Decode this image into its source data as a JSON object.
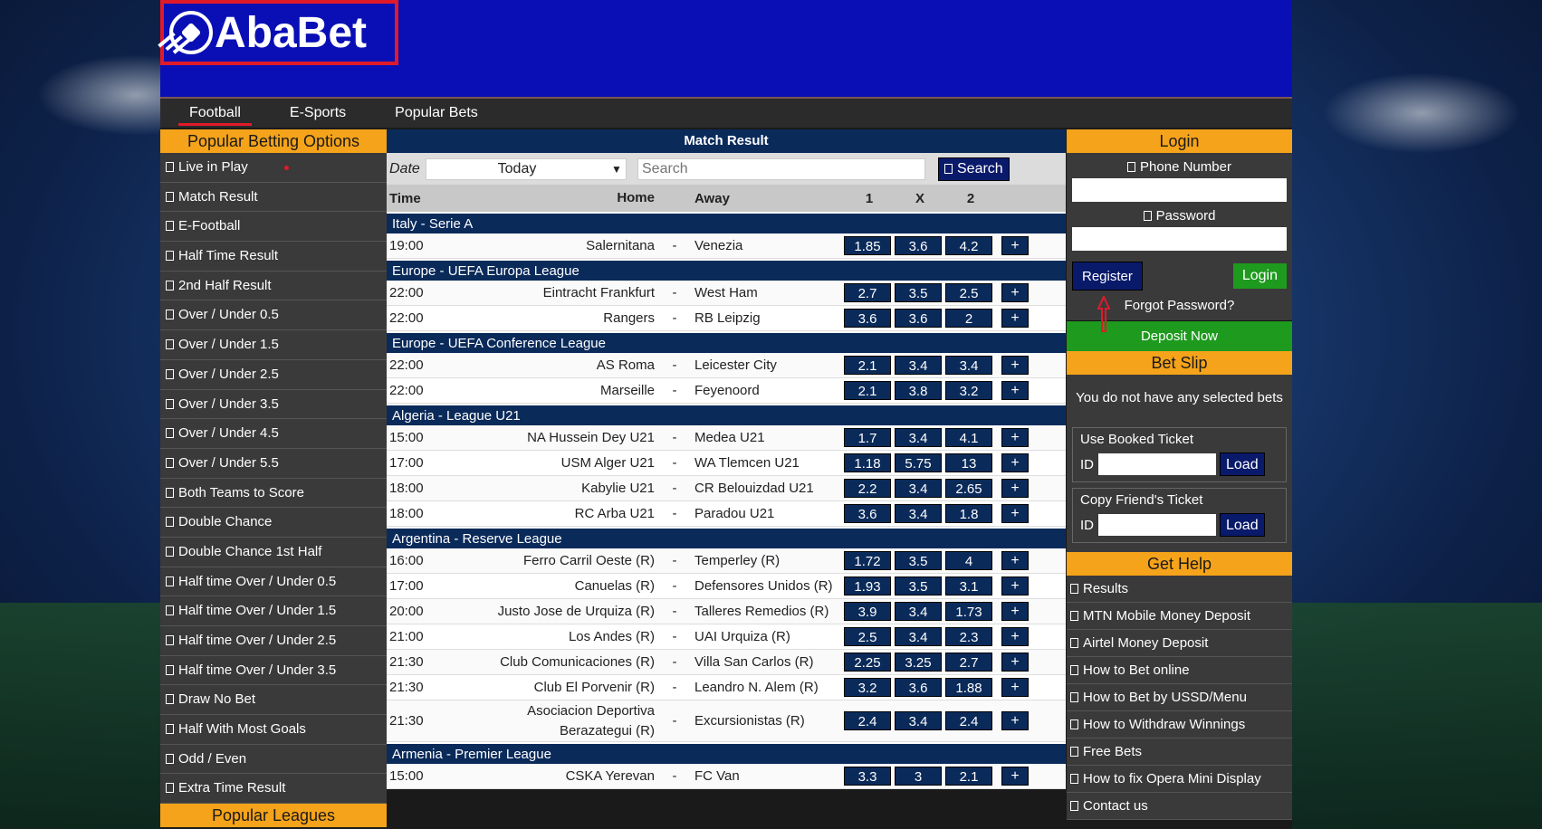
{
  "brand": {
    "name": "AbaBet",
    "accent": "#f5a31a",
    "header_bg": "#0a0fb5",
    "navy": "#0a2a5a",
    "green": "#1e9a1e"
  },
  "nav": {
    "tabs": [
      {
        "label": "Football",
        "active": true
      },
      {
        "label": "E-Sports"
      },
      {
        "label": "Popular Bets"
      }
    ]
  },
  "left": {
    "heading": "Popular Betting Options",
    "items": [
      "Live in Play",
      "Match Result",
      "E-Football",
      "Half Time Result",
      "2nd Half Result",
      "Over / Under 0.5",
      "Over / Under 1.5",
      "Over / Under 2.5",
      "Over / Under 3.5",
      "Over / Under 4.5",
      "Over / Under 5.5",
      "Both Teams to Score",
      "Double Chance",
      "Double Chance 1st Half",
      "Half time Over / Under 0.5",
      "Half time Over / Under 1.5",
      "Half time Over / Under 2.5",
      "Half time Over / Under 3.5",
      "Draw No Bet",
      "Half With Most Goals",
      "Odd / Even",
      "Extra Time Result"
    ],
    "footer_heading": "Popular Leagues"
  },
  "center": {
    "title": "Match Result",
    "filter": {
      "date_label": "Date",
      "date_value": "Today",
      "search_placeholder": "Search",
      "search_button": "Search"
    },
    "columns": {
      "time": "Time",
      "home": "Home",
      "away": "Away",
      "one": "1",
      "x": "X",
      "two": "2"
    },
    "leagues": [
      {
        "name": "Italy - Serie A",
        "matches": [
          {
            "time": "19:00",
            "home": "Salernitana",
            "away": "Venezia",
            "odds": [
              "1.85",
              "3.6",
              "4.2"
            ]
          }
        ]
      },
      {
        "name": "Europe - UEFA Europa League",
        "matches": [
          {
            "time": "22:00",
            "home": "Eintracht Frankfurt",
            "away": "West Ham",
            "odds": [
              "2.7",
              "3.5",
              "2.5"
            ]
          },
          {
            "time": "22:00",
            "home": "Rangers",
            "away": "RB Leipzig",
            "odds": [
              "3.6",
              "3.6",
              "2"
            ]
          }
        ]
      },
      {
        "name": "Europe - UEFA Conference League",
        "matches": [
          {
            "time": "22:00",
            "home": "AS Roma",
            "away": "Leicester City",
            "odds": [
              "2.1",
              "3.4",
              "3.4"
            ]
          },
          {
            "time": "22:00",
            "home": "Marseille",
            "away": "Feyenoord",
            "odds": [
              "2.1",
              "3.8",
              "3.2"
            ]
          }
        ]
      },
      {
        "name": "Algeria - League U21",
        "matches": [
          {
            "time": "15:00",
            "home": "NA Hussein Dey U21",
            "away": "Medea U21",
            "odds": [
              "1.7",
              "3.4",
              "4.1"
            ]
          },
          {
            "time": "17:00",
            "home": "USM Alger U21",
            "away": "WA Tlemcen U21",
            "odds": [
              "1.18",
              "5.75",
              "13"
            ]
          },
          {
            "time": "18:00",
            "home": "Kabylie U21",
            "away": "CR Belouizdad U21",
            "odds": [
              "2.2",
              "3.4",
              "2.65"
            ]
          },
          {
            "time": "18:00",
            "home": "RC Arba U21",
            "away": "Paradou U21",
            "odds": [
              "3.6",
              "3.4",
              "1.8"
            ]
          }
        ]
      },
      {
        "name": "Argentina - Reserve League",
        "matches": [
          {
            "time": "16:00",
            "home": "Ferro Carril Oeste (R)",
            "away": "Temperley (R)",
            "odds": [
              "1.72",
              "3.5",
              "4"
            ]
          },
          {
            "time": "17:00",
            "home": "Canuelas (R)",
            "away": "Defensores Unidos (R)",
            "odds": [
              "1.93",
              "3.5",
              "3.1"
            ]
          },
          {
            "time": "20:00",
            "home": "Justo Jose de Urquiza (R)",
            "away": "Talleres Remedios (R)",
            "odds": [
              "3.9",
              "3.4",
              "1.73"
            ]
          },
          {
            "time": "21:00",
            "home": "Los Andes (R)",
            "away": "UAI Urquiza (R)",
            "odds": [
              "2.5",
              "3.4",
              "2.3"
            ]
          },
          {
            "time": "21:30",
            "home": "Club Comunicaciones (R)",
            "away": "Villa San Carlos (R)",
            "odds": [
              "2.25",
              "3.25",
              "2.7"
            ]
          },
          {
            "time": "21:30",
            "home": "Club El Porvenir (R)",
            "away": "Leandro N. Alem (R)",
            "odds": [
              "3.2",
              "3.6",
              "1.88"
            ]
          },
          {
            "time": "21:30",
            "home": "Asociacion Deportiva Berazategui (R)",
            "away": "Excursionistas (R)",
            "odds": [
              "2.4",
              "3.4",
              "2.4"
            ],
            "tall": true
          }
        ]
      },
      {
        "name": "Armenia - Premier League",
        "matches": [
          {
            "time": "15:00",
            "home": "CSKA Yerevan",
            "away": "FC Van",
            "odds": [
              "3.3",
              "3",
              "2.1"
            ]
          }
        ]
      }
    ],
    "dash": "-",
    "plus": "+"
  },
  "right": {
    "login_heading": "Login",
    "phone_label": "Phone Number",
    "password_label": "Password",
    "register_button": "Register",
    "login_button": "Login",
    "forgot": "Forgot Password?",
    "deposit": "Deposit Now",
    "betslip_heading": "Bet Slip",
    "betslip_empty": "You do not have any selected bets",
    "booked_legend": "Use Booked Ticket",
    "friend_legend": "Copy Friend's Ticket",
    "id_label": "ID",
    "load_button": "Load",
    "help_heading": "Get Help",
    "help_items": [
      "Results",
      "MTN Mobile Money Deposit",
      "Airtel Money Deposit",
      "How to Bet online",
      "How to Bet by USSD/Menu",
      "How to Withdraw Winnings",
      "Free Bets",
      "How to fix Opera Mini Display",
      "Contact us"
    ]
  }
}
